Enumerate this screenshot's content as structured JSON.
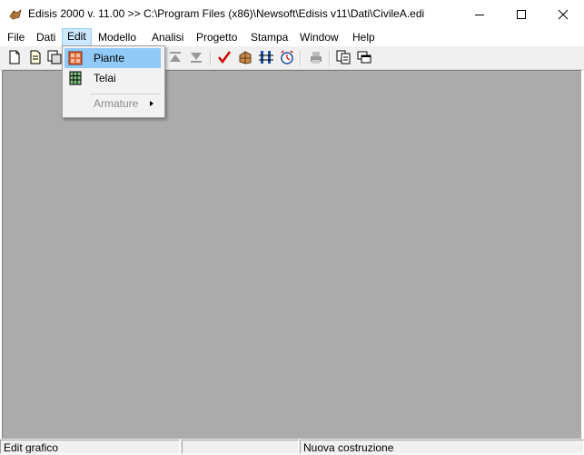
{
  "window": {
    "title": "Edisis 2000 v. 11.00 >> C:\\Program Files (x86)\\Newsoft\\Edisis v11\\Dati\\CivileA.edi"
  },
  "menubar": {
    "items": [
      {
        "label": "File"
      },
      {
        "label": "Dati"
      },
      {
        "label": "Edit"
      },
      {
        "label": "Modello"
      },
      {
        "label": "Analisi"
      },
      {
        "label": "Progetto"
      },
      {
        "label": "Stampa"
      },
      {
        "label": "Window"
      },
      {
        "label": "Help"
      }
    ]
  },
  "edit_menu": {
    "items": [
      {
        "label": "Piante",
        "icon": "floor-plan-icon",
        "highlighted": true
      },
      {
        "label": "Telai",
        "icon": "frame-grid-icon"
      },
      {
        "label": "Armature",
        "disabled": true,
        "submenu": true
      }
    ]
  },
  "toolbar": {
    "buttons": [
      "new-document-icon",
      "open-document-icon",
      "save-document-icon",
      "move-up-icon",
      "move-down-icon",
      "check-icon",
      "building-icon",
      "columns-icon",
      "clock-icon",
      "print-icon",
      "copy-icon",
      "window-cascade-icon"
    ]
  },
  "statusbar": {
    "left": "Edit grafico",
    "middle": "",
    "right": "Nuova costruzione"
  },
  "colors": {
    "workspace": "#ababab",
    "menu_highlight": "#91c9f7",
    "menu_open": "#cce8ff"
  }
}
